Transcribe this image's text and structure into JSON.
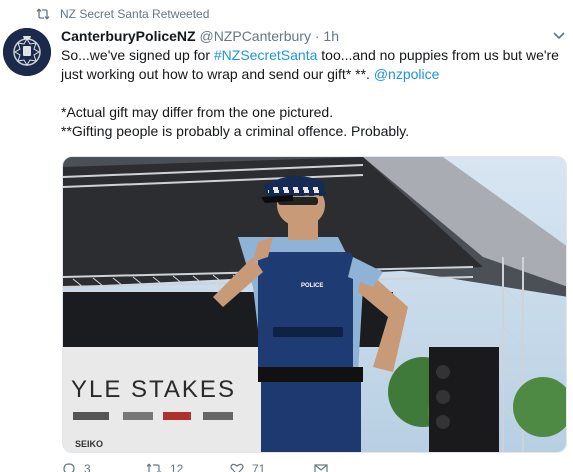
{
  "retweet_context": {
    "text": "NZ Secret Santa Retweeted",
    "icon": "retweet-icon"
  },
  "author": {
    "name": "CanterburyPoliceNZ",
    "handle": "@NZPCanterbury",
    "separator": "·",
    "time": "1h"
  },
  "tweet": {
    "line1_pre": "So...we've signed up for ",
    "hashtag": "#NZSecretSanta",
    "line1_post": " too...and no puppies from us but we're just working out how to wrap and send our gift* **. ",
    "mention": "@nzpolice",
    "note1": "*Actual gift may differ from the one pictured.",
    "note2": "**Gifting people is probably a criminal offence. Probably."
  },
  "media": {
    "banner_text": "YLE STAKES",
    "sponsor_text": "SEIKO",
    "vest_text": "POLICE"
  },
  "actions": {
    "reply_count": "3",
    "retweet_count": "12",
    "like_count": "71"
  },
  "colors": {
    "link": "#1b95e0",
    "muted": "#657786",
    "police_blue": "#1f3b73"
  }
}
